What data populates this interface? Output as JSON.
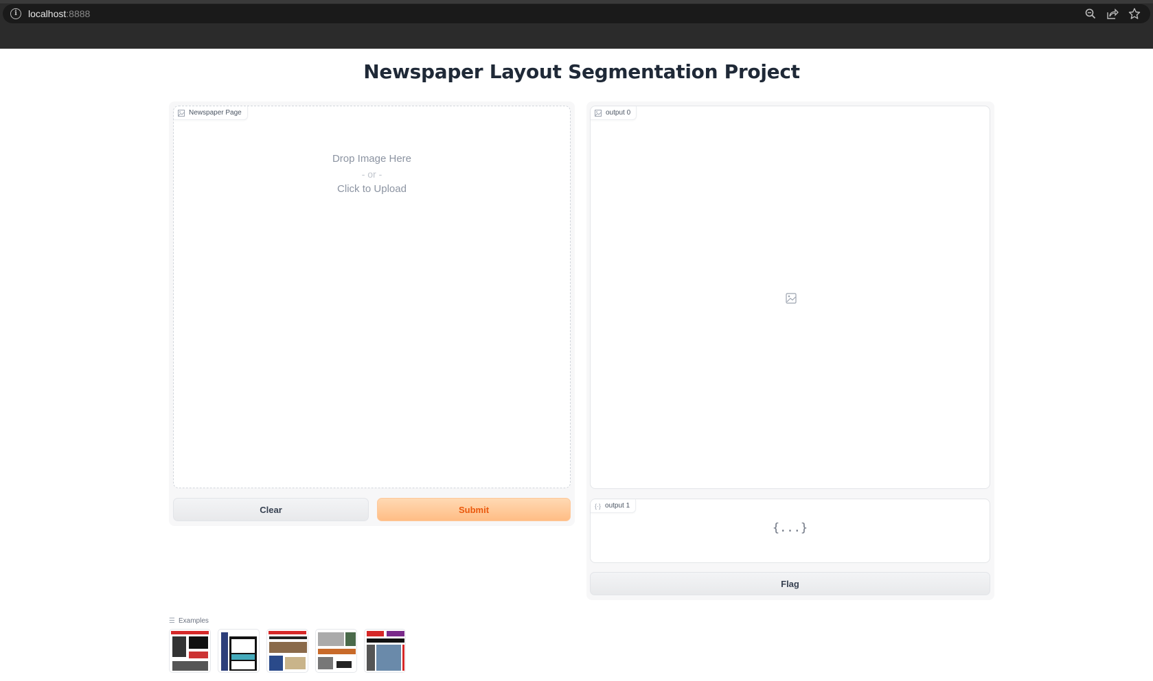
{
  "browser": {
    "url_host": "localhost",
    "url_port": ":8888",
    "icons": [
      "info-icon",
      "zoom-icon",
      "share-icon",
      "bookmark-star-icon"
    ]
  },
  "page": {
    "title": "Newspaper Layout Segmentation Project"
  },
  "input": {
    "label": "Newspaper Page",
    "label_icon": "image-icon",
    "drop_text": "Drop Image Here",
    "or_text": "- or -",
    "upload_text": "Click to Upload"
  },
  "buttons": {
    "clear": "Clear",
    "submit": "Submit",
    "flag": "Flag"
  },
  "outputs": [
    {
      "label": "output 0",
      "icon": "image-icon",
      "placeholder_icon": "image-icon"
    },
    {
      "label": "output 1",
      "icon": "json-icon",
      "placeholder": "{...}"
    }
  ],
  "examples": {
    "label": "Examples",
    "items": [
      {
        "name": "newspaper-example-1"
      },
      {
        "name": "newspaper-example-2"
      },
      {
        "name": "newspaper-example-3"
      },
      {
        "name": "newspaper-example-4"
      },
      {
        "name": "newspaper-example-5"
      }
    ]
  },
  "colors": {
    "accent": "#ea580c",
    "submit_bg": "#ffc58f",
    "browser_bg": "#2b2b2b"
  }
}
